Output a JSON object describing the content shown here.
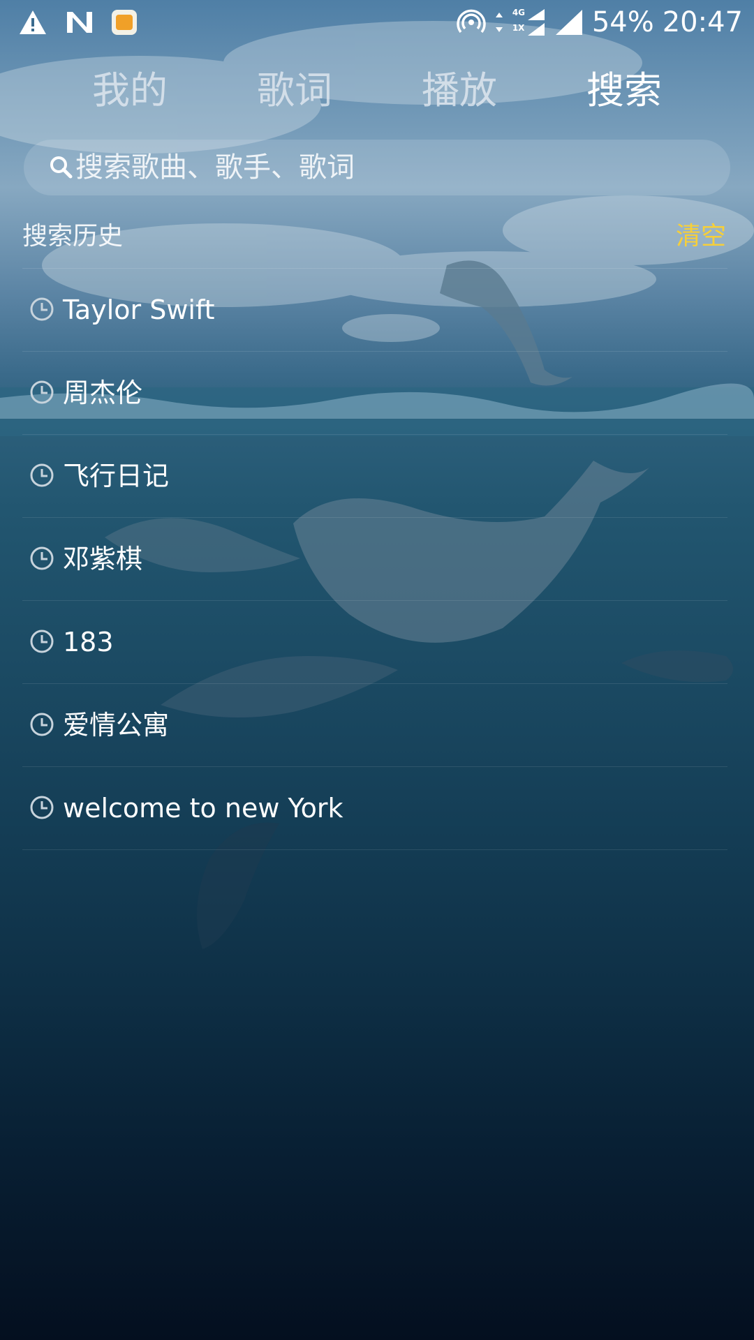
{
  "status_bar": {
    "battery": "54%",
    "time": "20:47",
    "network_type": "4G",
    "sim_label": "1X",
    "icons": [
      "warning-icon",
      "n-logo-icon",
      "app-badge-icon",
      "hotspot-icon",
      "data-arrows-icon",
      "signal-icon"
    ]
  },
  "tabs": [
    {
      "label": "我的"
    },
    {
      "label": "歌词"
    },
    {
      "label": "播放"
    },
    {
      "label": "搜索"
    }
  ],
  "active_tab": "搜索",
  "search": {
    "placeholder": "搜索歌曲、歌手、歌词",
    "icon": "search-icon"
  },
  "history": {
    "title": "搜索历史",
    "clear_label": "清空",
    "items": [
      {
        "text": "Taylor Swift"
      },
      {
        "text": "周杰伦"
      },
      {
        "text": "飞行日记"
      },
      {
        "text": "邓紫棋"
      },
      {
        "text": "183"
      },
      {
        "text": "爱情公寓"
      },
      {
        "text": "welcome to new York"
      }
    ],
    "item_icon": "clock-icon"
  },
  "colors": {
    "accent": "#f6cf3a",
    "text": "#ffffff",
    "tab_inactive": "#dfe6ee"
  }
}
